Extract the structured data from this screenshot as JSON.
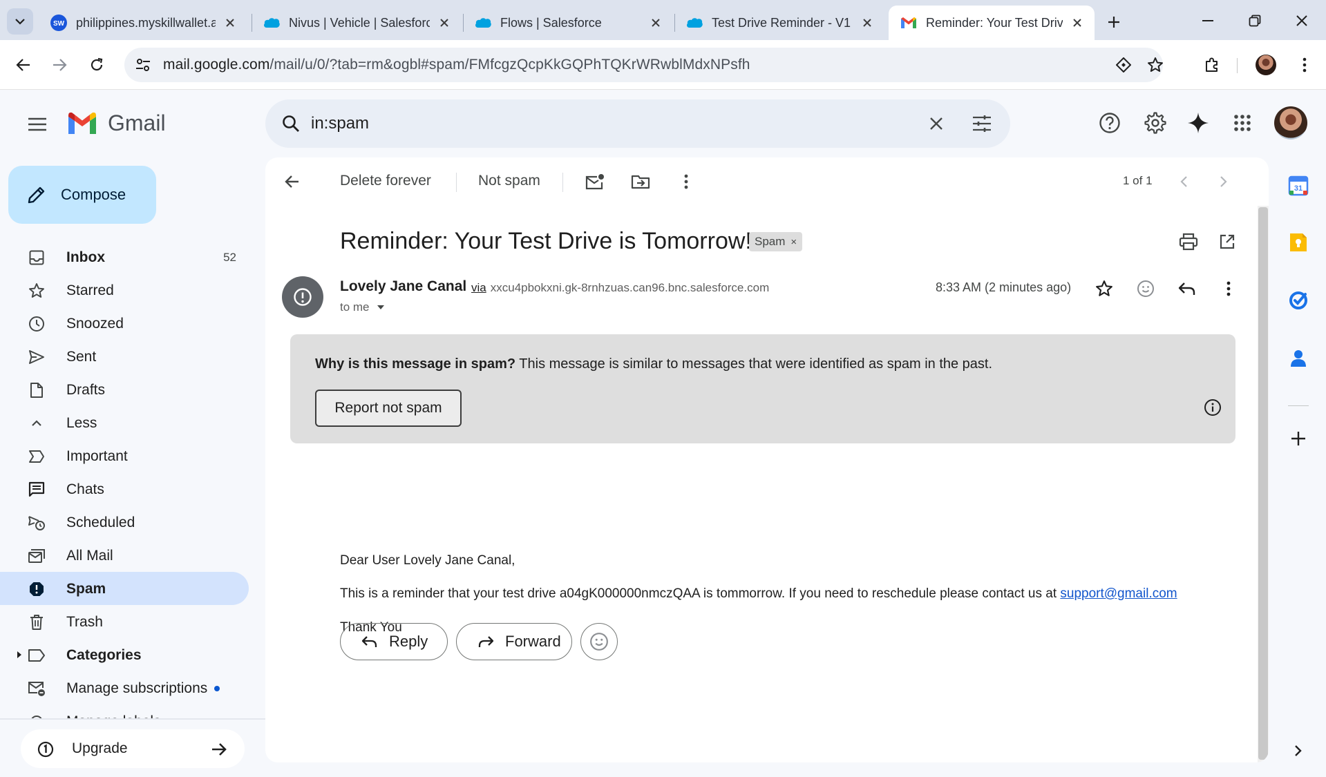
{
  "browser": {
    "tabs": [
      {
        "title": "philippines.myskillwallet.ai",
        "favicon": "skillwallet-icon",
        "active": false
      },
      {
        "title": "Nivus | Vehicle | Salesforce",
        "favicon": "salesforce-cloud-icon",
        "active": false
      },
      {
        "title": "Flows | Salesforce",
        "favicon": "salesforce-cloud-icon",
        "active": false
      },
      {
        "title": "Test Drive Reminder - V1",
        "favicon": "salesforce-cloud-icon",
        "active": false
      },
      {
        "title": "Reminder: Your Test Drive is Tomorrow!",
        "favicon": "gmail-icon",
        "active": true
      }
    ],
    "skillwallet_favicon_text": "SW",
    "url_host": "mail.google.com",
    "url_path": "/mail/u/0/?tab=rm&ogbl#spam/FMfcgzQcpKkGQPhTQKrWRwblMdxNPsfh"
  },
  "gmail": {
    "product_name": "Gmail",
    "search_query": "in:spam",
    "compose_label": "Compose",
    "nav": {
      "inbox": {
        "label": "Inbox",
        "count": "52"
      },
      "starred": "Starred",
      "snoozed": "Snoozed",
      "sent": "Sent",
      "drafts": "Drafts",
      "less": "Less",
      "important": "Important",
      "chats": "Chats",
      "scheduled": "Scheduled",
      "all_mail": "All Mail",
      "spam": "Spam",
      "trash": "Trash",
      "categories": "Categories",
      "manage_subscriptions": "Manage subscriptions",
      "manage_labels": "Manage labels"
    },
    "upgrade_label": "Upgrade"
  },
  "message_toolbar": {
    "delete_forever": "Delete forever",
    "not_spam": "Not spam",
    "pager": "1 of 1"
  },
  "message": {
    "subject": "Reminder: Your Test Drive is Tomorrow!",
    "label": "Spam",
    "label_remove": "×",
    "sender_name": "Lovely Jane Canal",
    "via_word": "via",
    "sender_domain": "xxcu4pbokxni.gk-8rnhzuas.can96.bnc.salesforce.com",
    "to": "to me",
    "time": "8:33 AM (2 minutes ago)",
    "spam_why_bold": "Why is this message in spam?",
    "spam_why_text": " This message is similar to messages that were identified as spam in the past.",
    "report_not_spam": "Report not spam",
    "body": {
      "greeting": "Dear User Lovely Jane Canal,",
      "line_before_link": "This is a reminder that your test drive a04gK000000nmczQAA is tommorrow. If you need to reschedule please contact us at ",
      "link": "support@gmail.com",
      "closing": "Thank You"
    },
    "reply_label": "Reply",
    "forward_label": "Forward"
  },
  "side_panel": {
    "calendar_day": "31"
  },
  "colors": {
    "accent": "#0b57d0",
    "compose_bg": "#c2e7ff",
    "active_nav": "#d3e3fd",
    "spam_box": "#dedede",
    "link": "#1155cc"
  }
}
